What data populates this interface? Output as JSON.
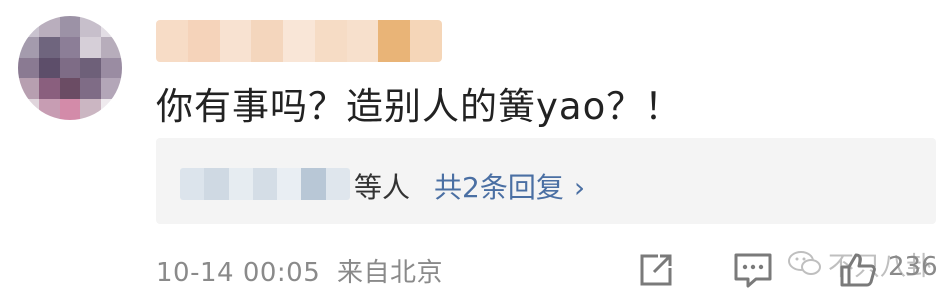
{
  "comment": {
    "text": "你有事吗？造别人的簧yao？！"
  },
  "replies": {
    "suffix": "等人",
    "link_label": "共2条回复",
    "chevron": "›"
  },
  "meta": {
    "timestamp": "10-14 00:05",
    "source": "来自北京"
  },
  "actions": {
    "share_icon": "share-icon",
    "comment_icon": "comment-icon",
    "like_icon": "like-icon",
    "like_count": "236"
  },
  "watermark": {
    "text": "不只八卦"
  },
  "colors": {
    "text": "#222222",
    "link": "#4a6fa3",
    "meta": "#8a8a8a",
    "reply_bg": "#f4f4f4"
  }
}
